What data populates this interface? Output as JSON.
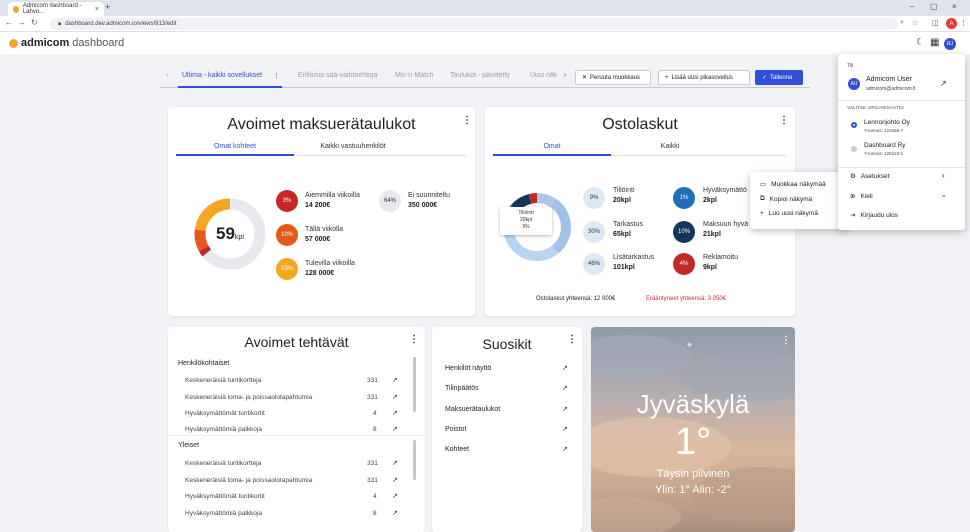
{
  "browser": {
    "tab_title": "Admicom dashboard - Lahvo...",
    "url": "dashboard.dev.admicom.io/views/913/edit",
    "profile_initial": "A"
  },
  "app": {
    "brand": "admicom",
    "product": "dashboard",
    "avatar": "RJ"
  },
  "dashboard_tabs": [
    {
      "label": "Ultima - kaikki sovellukset",
      "active": true
    },
    {
      "label": "Erillaisia sää-vaihtoehtoja"
    },
    {
      "label": "Mix-n-Match"
    },
    {
      "label": "Taulukot - päivitetty"
    },
    {
      "label": "Uusi näk"
    }
  ],
  "actions": {
    "cancel": "Peruuta muokkaus",
    "add": "Lisää uusi pikasovellus",
    "save": "Tallenna"
  },
  "maksuerat": {
    "title": "Avoimet maksuerätaulukot",
    "tabs": [
      "Omat kohteet",
      "Kaikki vastuuhenkilöt"
    ],
    "center_value": "59",
    "center_unit": "kpl",
    "items": [
      {
        "pct": "3%",
        "label": "Aiemmilla viikoilla",
        "value": "14 200€",
        "color": "#c62828"
      },
      {
        "pct": "10%",
        "label": "Tällä viikolla",
        "value": "57 000€",
        "color": "#e55a1c"
      },
      {
        "pct": "23%",
        "label": "Tulevilla viikoilla",
        "value": "128 000€",
        "color": "#f5a623"
      },
      {
        "pct": "64%",
        "label": "Ei suunniteltu",
        "value": "350 000€",
        "color": "#e7e9ee"
      }
    ]
  },
  "ostolaskut": {
    "title": "Ostolaskut",
    "tabs": [
      "Omat",
      "Kaikki"
    ],
    "tooltip": {
      "title": "Tiliöinti",
      "count": "20kpl",
      "pct": "9%"
    },
    "items": [
      {
        "pct": "9%",
        "label": "Tiliöinti",
        "value": "20kpl",
        "color": "#dce9f6"
      },
      {
        "pct": "30%",
        "label": "Tarkastus",
        "value": "65kpl",
        "color": "#dce9f6"
      },
      {
        "pct": "46%",
        "label": "Lisätarkastus",
        "value": "101kpl",
        "color": "#dce9f6"
      },
      {
        "pct": "1%",
        "label": "Hyväksymättö",
        "value": "2kpl",
        "color": "#1e6fb8"
      },
      {
        "pct": "10%",
        "label": "Maksuun hyvä",
        "value": "21kpl",
        "color": "#12365c"
      },
      {
        "pct": "4%",
        "label": "Reklamoitu",
        "value": "9kpl",
        "color": "#c62828"
      }
    ],
    "total": "Ostolaskut yhteensä: 12 000€",
    "overdue": "Erääntyneet yhteensä: 3 050€"
  },
  "tehtavat": {
    "title": "Avoimet tehtävät",
    "sections": [
      {
        "name": "Henkilökohtaiset",
        "rows": [
          {
            "label": "Keskeneräisiä tuntikortteja",
            "count": "331"
          },
          {
            "label": "Keskeneräisiä loma- ja poissaolotapahtumia",
            "count": "331"
          },
          {
            "label": "Hyväksymättömät tuntikortit",
            "count": "4"
          },
          {
            "label": "Hyväksymättömiä palkkoja",
            "count": "8"
          }
        ]
      },
      {
        "name": "Yleiset",
        "rows": [
          {
            "label": "Keskeneräisiä tuntikortteja",
            "count": "331"
          },
          {
            "label": "Keskeneräisiä loma- ja poissaolotapahtumia",
            "count": "331"
          },
          {
            "label": "Hyväksymättömät tuntikortit",
            "count": "4"
          },
          {
            "label": "Hyväksymättömiä palkkoja",
            "count": "8"
          }
        ]
      }
    ]
  },
  "suosikit": {
    "title": "Suosikit",
    "items": [
      "Henkilöt näyttö",
      "Tilinpäätös",
      "Maksuerätaulukot",
      "Poistot",
      "Kohteet"
    ]
  },
  "weather": {
    "city": "Jyväskylä",
    "temp": "1°",
    "desc": "Täysin pilvinen",
    "range": "Ylin: 1°  Alin: -2°"
  },
  "context_menu": {
    "items": [
      "Muokkaa näkymää",
      "Kopioi näkymä",
      "Luo uusi näkymä"
    ]
  },
  "user_menu": {
    "account_header": "Tili",
    "user_name": "Admicom User",
    "user_email": "admicom@admicom.fi",
    "user_initials": "AU",
    "org_header": "Valitse organisaatio",
    "orgs": [
      {
        "name": "Lennonjohto Oy",
        "id": "Y-tunnus: 123456-7",
        "selected": true
      },
      {
        "name": "Dashboard Ry",
        "id": "Y-tunnus: 125123-1",
        "selected": false
      }
    ],
    "settings": "Asetukset",
    "language": "Kieli",
    "logout": "Kirjaudu ulos"
  }
}
